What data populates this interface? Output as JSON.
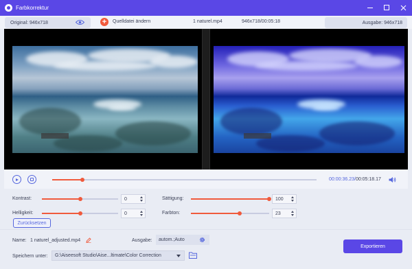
{
  "window": {
    "title": "Farbkorrektur",
    "accent": "#5a47e6",
    "highlight": "#f05a3c"
  },
  "infobar": {
    "original_label": "Original: 946x718",
    "add_source_label": "Quelldatei ändern",
    "file_name": "1 naturel.mp4",
    "file_meta": "946x718/00:05:18",
    "output_label": "Ausgabe: 946x718"
  },
  "playback": {
    "current_time": "00:00:36.23",
    "separator": "/",
    "total_time": "00:05:18.17",
    "progress_fraction": 0.114
  },
  "adjustments": {
    "contrast": {
      "label": "Kontrast:",
      "value": "0",
      "fraction": 0.5
    },
    "saturation": {
      "label": "Sättigung:",
      "value": "100",
      "fraction": 1.0
    },
    "brightness": {
      "label": "Helligkeit:",
      "value": "0",
      "fraction": 0.5
    },
    "hue": {
      "label": "Farbton:",
      "value": "23",
      "fraction": 0.62
    },
    "reset_label": "Zurücksetzen"
  },
  "output": {
    "name_label": "Name:",
    "name_value": "1 naturel_adjusted.mp4",
    "format_label": "Ausgabe:",
    "format_value": "autom.;Auto",
    "save_label": "Speichern unter:",
    "save_path": "G:\\Aiseesoft Studio\\Aise...ltimate\\Color Correction",
    "export_label": "Exportieren"
  }
}
